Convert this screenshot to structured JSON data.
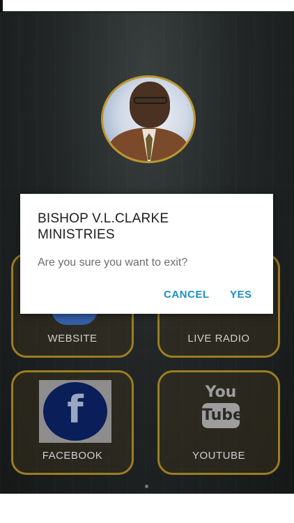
{
  "dialog": {
    "title": "BISHOP V.L.CLARKE MINISTRIES",
    "message": "Are you sure you want to exit?",
    "cancel_label": "CANCEL",
    "yes_label": "YES"
  },
  "tiles": [
    {
      "label": "WEBSITE",
      "icon": "globe-icon"
    },
    {
      "label": "LIVE RADIO",
      "icon": "radio-icon"
    },
    {
      "label": "FACEBOOK",
      "icon": "facebook-icon"
    },
    {
      "label": "YOUTUBE",
      "icon": "youtube-icon"
    }
  ],
  "icons": {
    "facebook_glyph": "f",
    "youtube_top": "You",
    "youtube_bottom": "Tube"
  },
  "colors": {
    "accent": "#1b8fc4",
    "tile_border": "#9b7e22",
    "facebook_blue": "#0a1e5a"
  }
}
